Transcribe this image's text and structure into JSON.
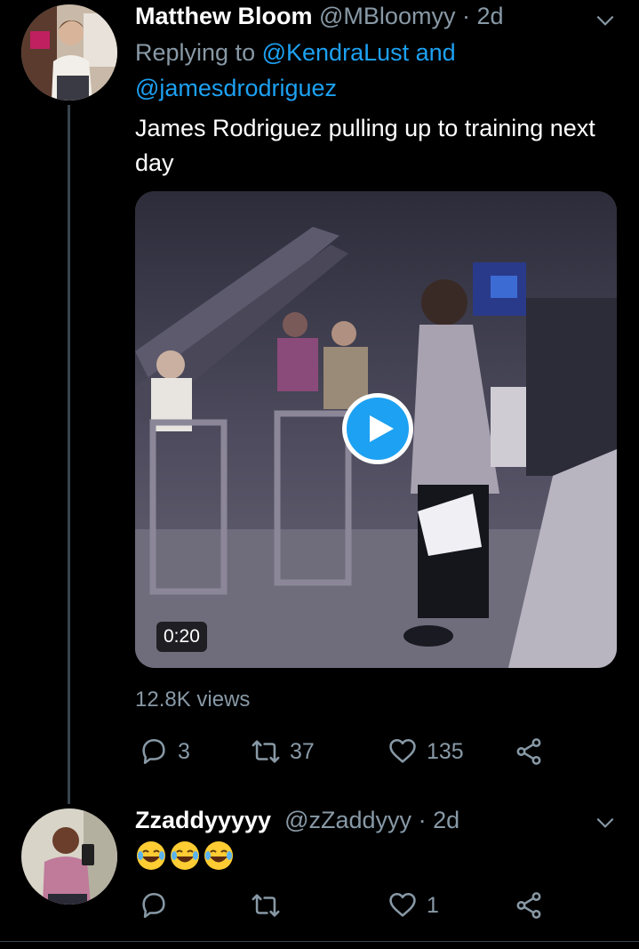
{
  "tweet1": {
    "name": "Matthew Bloom",
    "handle": "@MBloomyy",
    "separator": "·",
    "time": "2d",
    "replying_prefix": "Replying to",
    "mention1": "@KendraLust",
    "and_word": "and",
    "mention2": "@jamesdrodriguez",
    "text": "James Rodriguez pulling up to training next day",
    "video_duration": "0:20",
    "views": "12.8K views",
    "reply_count": "3",
    "retweet_count": "37",
    "like_count": "135"
  },
  "tweet2": {
    "name": "Zzaddyyyyy",
    "name_suffix": " ",
    "handle": "@zZaddyyy",
    "separator": "·",
    "time": "2d",
    "text_emoji": "😂😂😂",
    "reply_count": "",
    "retweet_count": "",
    "like_count": "1"
  },
  "colors": {
    "background": "#000000",
    "accent": "#1da1f2",
    "secondary_text": "#8899a6",
    "primary_text": "#ffffff",
    "divider": "#38444d"
  },
  "icons": {
    "reply": "reply-icon",
    "retweet": "retweet-icon",
    "like": "heart-icon",
    "share": "share-icon",
    "more": "chevron-down-icon",
    "play": "play-icon"
  }
}
